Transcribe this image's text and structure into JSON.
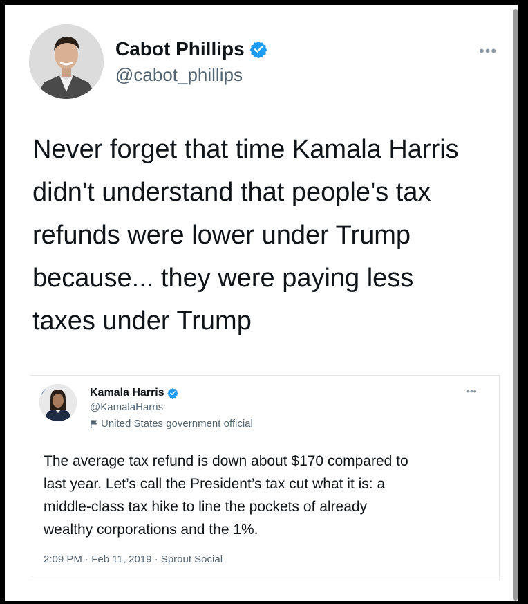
{
  "author": {
    "name": "Cabot Phillips",
    "handle": "@cabot_phillips"
  },
  "tweet": {
    "lines": [
      "Never forget that time Kamala Harris",
      "didn't understand that people's tax",
      "refunds were lower under Trump",
      "because... they were paying less",
      "taxes under Trump"
    ]
  },
  "quoted": {
    "name": "Kamala Harris",
    "handle": "@KamalaHarris",
    "label": "United States government official",
    "lines": [
      "The average tax refund is down about $170 compared to",
      "last year. Let’s call the President’s tax cut what it is: a",
      "middle-class tax hike to line the pockets of already",
      "wealthy corporations and the 1%."
    ],
    "meta": "2:09 PM · Feb 11, 2019 · Sprout Social"
  },
  "icons": {
    "verified": "verified-badge-icon",
    "more": "more-options-icon",
    "label": "flag-icon"
  },
  "colors": {
    "verified": "#1d9bf0",
    "text": "#0f1419",
    "secondary": "#536471"
  }
}
